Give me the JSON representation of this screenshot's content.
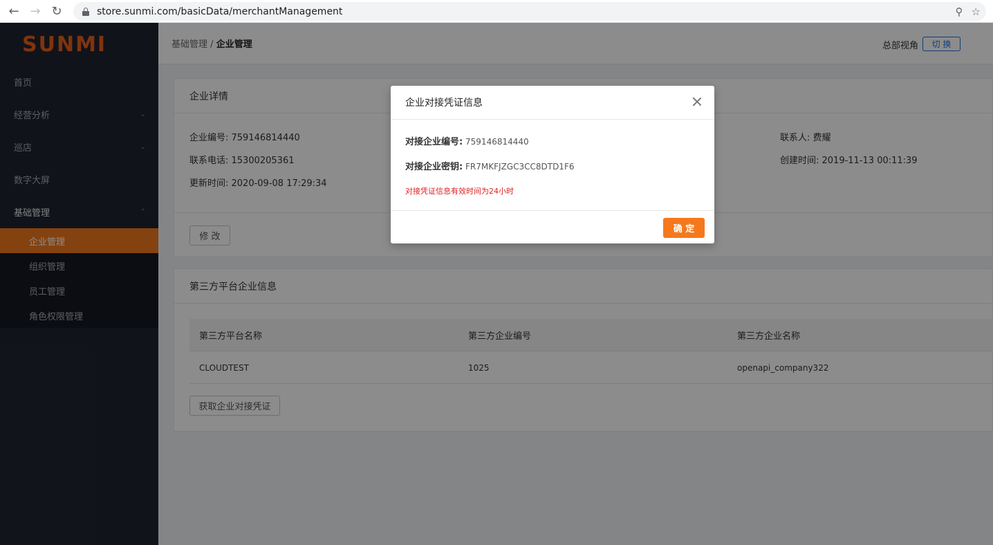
{
  "browser": {
    "back_icon": "arrow-left-icon",
    "forward_icon": "arrow-right-icon",
    "reload_icon": "reload-icon",
    "url": "store.sunmi.com/basicData/merchantManagement",
    "zoom_icon": "zoom-icon",
    "star_icon": "star-icon"
  },
  "sidebar": {
    "logo": "SUNMI",
    "items": [
      {
        "label": "首页"
      },
      {
        "label": "经营分析"
      },
      {
        "label": "巡店"
      },
      {
        "label": "数字大屏"
      },
      {
        "label": "基础管理"
      }
    ],
    "subitems": [
      {
        "label": "企业管理"
      },
      {
        "label": "组织管理"
      },
      {
        "label": "员工管理"
      },
      {
        "label": "角色权限管理"
      }
    ]
  },
  "header": {
    "breadcrumb_parent": "基础管理",
    "breadcrumb_sep": "/",
    "breadcrumb_current": "企业管理",
    "view_label": "总部视角",
    "switch_label": "切 换"
  },
  "enterprise": {
    "title": "企业详情",
    "id_line": "企业编号: 759146814440",
    "phone_line": "联系电话: 15300205361",
    "updated_line": "更新时间: 2020-09-08 17:29:34",
    "contact_line": "联系人: 费耀",
    "created_line": "创建时间: 2019-11-13 00:11:39",
    "edit_label": "修 改"
  },
  "third_party": {
    "title": "第三方平台企业信息",
    "columns": [
      "第三方平台名称",
      "第三方企业编号",
      "第三方企业名称"
    ],
    "rows": [
      [
        "CLOUDTEST",
        "1025",
        "openapi_company322"
      ]
    ],
    "get_credential_label": "获取企业对接凭证"
  },
  "modal": {
    "title": "企业对接凭证信息",
    "id_label": "对接企业编号:",
    "id_value": "759146814440",
    "key_label": "对接企业密钥:",
    "key_value": "FR7MKFJZGC3CC8DTD1F6",
    "warning": "对接凭证信息有效时间为24小时",
    "ok_label": "确 定"
  },
  "colors": {
    "brand_orange": "#f0781e",
    "sidebar_bg": "#1f2430",
    "link_blue": "#1f6fd6",
    "warning_red": "#e02020"
  }
}
